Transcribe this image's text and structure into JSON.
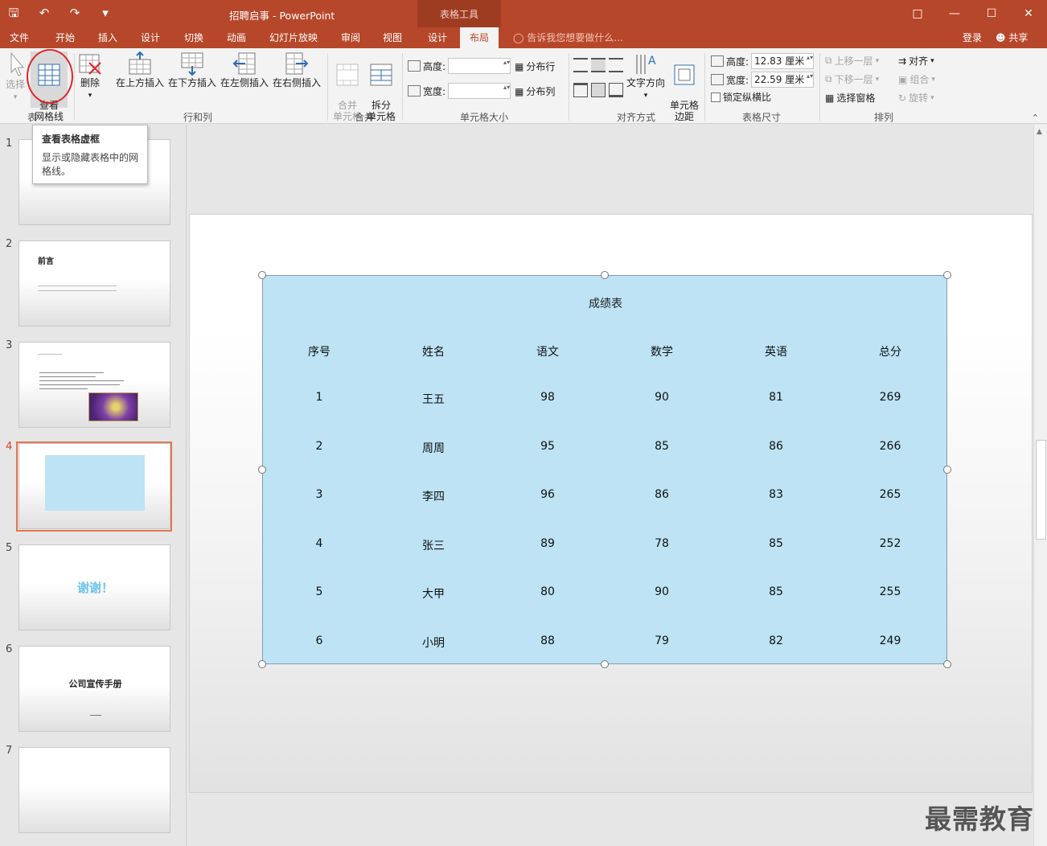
{
  "window": {
    "title": "招聘启事 - PowerPoint",
    "context_tab_group": "表格工具"
  },
  "tabs": [
    "文件",
    "开始",
    "插入",
    "设计",
    "切换",
    "动画",
    "幻灯片放映",
    "审阅",
    "视图",
    "设计",
    "布局"
  ],
  "tell_me": "告诉我您想要做什么...",
  "account": {
    "login": "登录",
    "share": "共享"
  },
  "ribbon": {
    "table_group": {
      "label": "表",
      "select": "选择",
      "view_gridlines": "查看\n网格线"
    },
    "rows_cols_group": {
      "label": "行和列",
      "delete": "删除",
      "insert_above": "在上方插入",
      "insert_below": "在下方插入",
      "insert_left": "在左侧插入",
      "insert_right": "在右侧插入"
    },
    "merge_group": {
      "label": "合并",
      "merge_cells": "合并\n单元格",
      "split_cells": "拆分\n单元格"
    },
    "cell_size_group": {
      "label": "单元格大小",
      "height": "高度:",
      "width": "宽度:",
      "distribute_rows": "分布行",
      "distribute_cols": "分布列"
    },
    "alignment_group": {
      "label": "对齐方式",
      "text_direction": "文字方向",
      "cell_margins": "单元格\n边距"
    },
    "table_size_group": {
      "label": "表格尺寸",
      "height": "高度:",
      "height_value": "12.83 厘米",
      "width": "宽度:",
      "width_value": "22.59 厘米",
      "lock_ratio": "锁定纵横比"
    },
    "arrange_group": {
      "label": "排列",
      "bring_forward": "上移一层",
      "send_backward": "下移一层",
      "selection_pane": "选择窗格",
      "align": "对齐",
      "group": "组合",
      "rotate": "旋转"
    }
  },
  "tooltip": {
    "title": "查看表格虚框",
    "body": "显示或隐藏表格中的网格线。"
  },
  "thumbnails": [
    {
      "number": "1"
    },
    {
      "number": "2",
      "title": "前言"
    },
    {
      "number": "3"
    },
    {
      "number": "4"
    },
    {
      "number": "5",
      "title": "谢谢！"
    },
    {
      "number": "6",
      "title": "公司宣传手册"
    },
    {
      "number": "7"
    }
  ],
  "table": {
    "title": "成绩表",
    "headers": [
      "序号",
      "姓名",
      "语文",
      "数学",
      "英语",
      "总分"
    ],
    "rows": [
      [
        "1",
        "王五",
        "98",
        "90",
        "81",
        "269"
      ],
      [
        "2",
        "周周",
        "95",
        "85",
        "86",
        "266"
      ],
      [
        "3",
        "李四",
        "96",
        "86",
        "83",
        "265"
      ],
      [
        "4",
        "张三",
        "89",
        "78",
        "85",
        "252"
      ],
      [
        "5",
        "大甲",
        "80",
        "90",
        "85",
        "255"
      ],
      [
        "6",
        "小明",
        "88",
        "79",
        "82",
        "249"
      ]
    ]
  },
  "watermark": "最需教育",
  "colors": {
    "accent": "#b7472a",
    "table_fill": "#bde3f4",
    "selected_thumb": "#e3764e",
    "highlight_circle": "#e2242a"
  }
}
